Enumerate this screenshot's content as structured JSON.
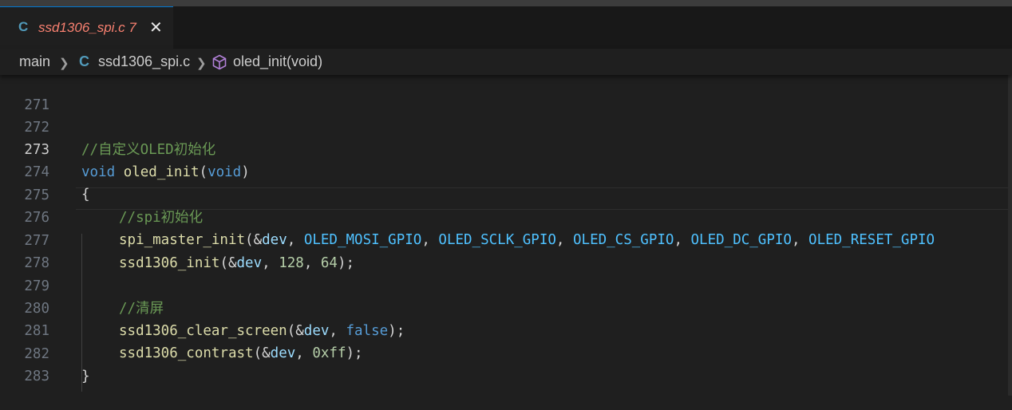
{
  "tab": {
    "file_icon": "C",
    "label": "ssd1306_spi.c",
    "problems": "7",
    "close_glyph": "✕"
  },
  "breadcrumb": {
    "folder": "main",
    "file_icon": "C",
    "file": "ssd1306_spi.c",
    "symbol": "oled_init(void)"
  },
  "editor": {
    "line_numbers": [
      "271",
      "272",
      "273",
      "274",
      "275",
      "276",
      "277",
      "278",
      "279",
      "280",
      "281",
      "282",
      "283"
    ],
    "lines": {
      "l272_comment": "//自定义OLED初始化",
      "l273_void": "void",
      "l273_fn": "oled_init",
      "l273_lparen": "(",
      "l273_param": "void",
      "l273_rparen": ")",
      "l274": "{",
      "l275_comment": "//spi初始化",
      "l276_fn": "spi_master_init",
      "l276_open": "(&",
      "l276_dev": "dev",
      "l276_sep1": ", ",
      "l276_a1": "OLED_MOSI_GPIO",
      "l276_sep2": ", ",
      "l276_a2": "OLED_SCLK_GPIO",
      "l276_sep3": ", ",
      "l276_a3": "OLED_CS_GPIO",
      "l276_sep4": ", ",
      "l276_a4": "OLED_DC_GPIO",
      "l276_sep5": ", ",
      "l276_a5": "OLED_RESET_GPIO",
      "l277_fn": "ssd1306_init",
      "l277_open": "(&",
      "l277_dev": "dev",
      "l277_sep1": ", ",
      "l277_n1": "128",
      "l277_sep2": ", ",
      "l277_n2": "64",
      "l277_close": ");",
      "l279_comment": "//清屏",
      "l280_fn": "ssd1306_clear_screen",
      "l280_open": "(&",
      "l280_dev": "dev",
      "l280_sep": ", ",
      "l280_arg": "false",
      "l280_close": ");",
      "l281_fn": "ssd1306_contrast",
      "l281_open": "(&",
      "l281_dev": "dev",
      "l281_sep": ", ",
      "l281_num": "0xff",
      "l281_close": ");",
      "l282": "}"
    }
  }
}
